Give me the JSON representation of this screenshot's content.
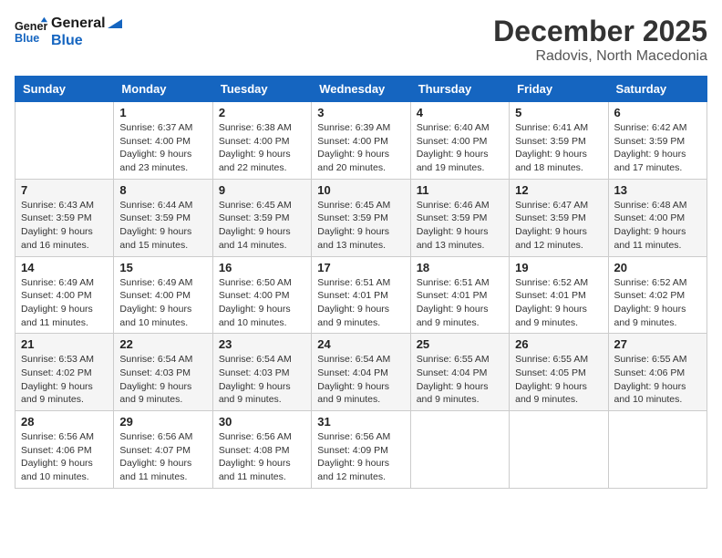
{
  "header": {
    "logo_line1": "General",
    "logo_line2": "Blue",
    "month_title": "December 2025",
    "subtitle": "Radovis, North Macedonia"
  },
  "weekdays": [
    "Sunday",
    "Monday",
    "Tuesday",
    "Wednesday",
    "Thursday",
    "Friday",
    "Saturday"
  ],
  "weeks": [
    [
      {
        "day": "",
        "info": ""
      },
      {
        "day": "1",
        "info": "Sunrise: 6:37 AM\nSunset: 4:00 PM\nDaylight: 9 hours\nand 23 minutes."
      },
      {
        "day": "2",
        "info": "Sunrise: 6:38 AM\nSunset: 4:00 PM\nDaylight: 9 hours\nand 22 minutes."
      },
      {
        "day": "3",
        "info": "Sunrise: 6:39 AM\nSunset: 4:00 PM\nDaylight: 9 hours\nand 20 minutes."
      },
      {
        "day": "4",
        "info": "Sunrise: 6:40 AM\nSunset: 4:00 PM\nDaylight: 9 hours\nand 19 minutes."
      },
      {
        "day": "5",
        "info": "Sunrise: 6:41 AM\nSunset: 3:59 PM\nDaylight: 9 hours\nand 18 minutes."
      },
      {
        "day": "6",
        "info": "Sunrise: 6:42 AM\nSunset: 3:59 PM\nDaylight: 9 hours\nand 17 minutes."
      }
    ],
    [
      {
        "day": "7",
        "info": "Sunrise: 6:43 AM\nSunset: 3:59 PM\nDaylight: 9 hours\nand 16 minutes."
      },
      {
        "day": "8",
        "info": "Sunrise: 6:44 AM\nSunset: 3:59 PM\nDaylight: 9 hours\nand 15 minutes."
      },
      {
        "day": "9",
        "info": "Sunrise: 6:45 AM\nSunset: 3:59 PM\nDaylight: 9 hours\nand 14 minutes."
      },
      {
        "day": "10",
        "info": "Sunrise: 6:45 AM\nSunset: 3:59 PM\nDaylight: 9 hours\nand 13 minutes."
      },
      {
        "day": "11",
        "info": "Sunrise: 6:46 AM\nSunset: 3:59 PM\nDaylight: 9 hours\nand 13 minutes."
      },
      {
        "day": "12",
        "info": "Sunrise: 6:47 AM\nSunset: 3:59 PM\nDaylight: 9 hours\nand 12 minutes."
      },
      {
        "day": "13",
        "info": "Sunrise: 6:48 AM\nSunset: 4:00 PM\nDaylight: 9 hours\nand 11 minutes."
      }
    ],
    [
      {
        "day": "14",
        "info": "Sunrise: 6:49 AM\nSunset: 4:00 PM\nDaylight: 9 hours\nand 11 minutes."
      },
      {
        "day": "15",
        "info": "Sunrise: 6:49 AM\nSunset: 4:00 PM\nDaylight: 9 hours\nand 10 minutes."
      },
      {
        "day": "16",
        "info": "Sunrise: 6:50 AM\nSunset: 4:00 PM\nDaylight: 9 hours\nand 10 minutes."
      },
      {
        "day": "17",
        "info": "Sunrise: 6:51 AM\nSunset: 4:01 PM\nDaylight: 9 hours\nand 9 minutes."
      },
      {
        "day": "18",
        "info": "Sunrise: 6:51 AM\nSunset: 4:01 PM\nDaylight: 9 hours\nand 9 minutes."
      },
      {
        "day": "19",
        "info": "Sunrise: 6:52 AM\nSunset: 4:01 PM\nDaylight: 9 hours\nand 9 minutes."
      },
      {
        "day": "20",
        "info": "Sunrise: 6:52 AM\nSunset: 4:02 PM\nDaylight: 9 hours\nand 9 minutes."
      }
    ],
    [
      {
        "day": "21",
        "info": "Sunrise: 6:53 AM\nSunset: 4:02 PM\nDaylight: 9 hours\nand 9 minutes."
      },
      {
        "day": "22",
        "info": "Sunrise: 6:54 AM\nSunset: 4:03 PM\nDaylight: 9 hours\nand 9 minutes."
      },
      {
        "day": "23",
        "info": "Sunrise: 6:54 AM\nSunset: 4:03 PM\nDaylight: 9 hours\nand 9 minutes."
      },
      {
        "day": "24",
        "info": "Sunrise: 6:54 AM\nSunset: 4:04 PM\nDaylight: 9 hours\nand 9 minutes."
      },
      {
        "day": "25",
        "info": "Sunrise: 6:55 AM\nSunset: 4:04 PM\nDaylight: 9 hours\nand 9 minutes."
      },
      {
        "day": "26",
        "info": "Sunrise: 6:55 AM\nSunset: 4:05 PM\nDaylight: 9 hours\nand 9 minutes."
      },
      {
        "day": "27",
        "info": "Sunrise: 6:55 AM\nSunset: 4:06 PM\nDaylight: 9 hours\nand 10 minutes."
      }
    ],
    [
      {
        "day": "28",
        "info": "Sunrise: 6:56 AM\nSunset: 4:06 PM\nDaylight: 9 hours\nand 10 minutes."
      },
      {
        "day": "29",
        "info": "Sunrise: 6:56 AM\nSunset: 4:07 PM\nDaylight: 9 hours\nand 11 minutes."
      },
      {
        "day": "30",
        "info": "Sunrise: 6:56 AM\nSunset: 4:08 PM\nDaylight: 9 hours\nand 11 minutes."
      },
      {
        "day": "31",
        "info": "Sunrise: 6:56 AM\nSunset: 4:09 PM\nDaylight: 9 hours\nand 12 minutes."
      },
      {
        "day": "",
        "info": ""
      },
      {
        "day": "",
        "info": ""
      },
      {
        "day": "",
        "info": ""
      }
    ]
  ]
}
